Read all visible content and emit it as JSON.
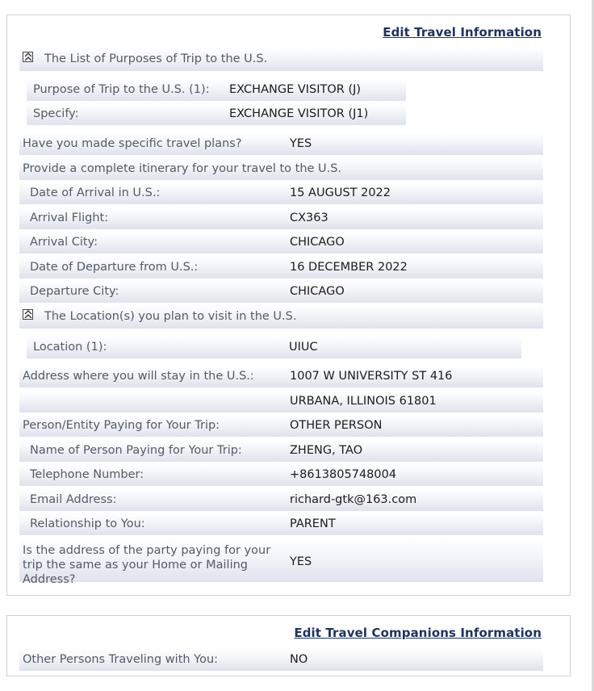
{
  "travel": {
    "edit_link": "Edit Travel Information",
    "purposes_section": {
      "title": "The List of Purposes of Trip to the U.S.",
      "purpose": {
        "label": "Purpose of Trip to the U.S. (1):",
        "value": "EXCHANGE VISITOR (J)"
      },
      "specify": {
        "label": "Specify:",
        "value": "EXCHANGE VISITOR (J1)"
      }
    },
    "travel_plans": {
      "label": "Have you made specific travel plans?",
      "value": "YES"
    },
    "itinerary_prompt": "Provide a complete itinerary for your travel to the U.S.",
    "arrival_date": {
      "label": "Date of Arrival in U.S.:",
      "value": "15 AUGUST 2022"
    },
    "arrival_flight": {
      "label": "Arrival Flight:",
      "value": "CX363"
    },
    "arrival_city": {
      "label": "Arrival City:",
      "value": "CHICAGO"
    },
    "departure_date": {
      "label": "Date of Departure from U.S.:",
      "value": "16 DECEMBER 2022"
    },
    "departure_city": {
      "label": "Departure City:",
      "value": "CHICAGO"
    },
    "locations_section": {
      "title": "The Location(s) you plan to visit in the U.S.",
      "location": {
        "label": "Location (1):",
        "value": "UIUC"
      }
    },
    "address": {
      "label": "Address where you will stay in the U.S.:",
      "line1": "1007 W UNIVERSITY ST 416",
      "line2": "URBANA, ILLINOIS 61801"
    },
    "payer": {
      "label": "Person/Entity Paying for Your Trip:",
      "value": "OTHER PERSON"
    },
    "payer_name": {
      "label": "Name of Person Paying for Your Trip:",
      "value": "ZHENG, TAO"
    },
    "phone": {
      "label": "Telephone Number:",
      "value": "+8613805748004"
    },
    "email": {
      "label": "Email Address:",
      "value": "richard-gtk@163.com"
    },
    "relationship": {
      "label": "Relationship to You:",
      "value": "PARENT"
    },
    "same_address": {
      "label": "Is the address of the party paying for your trip the same as your Home or Mailing Address?",
      "value": "YES"
    }
  },
  "companions": {
    "edit_link": "Edit Travel Companions Information",
    "others": {
      "label": "Other Persons Traveling with You:",
      "value": "NO"
    }
  },
  "icons": {
    "collapse": "collapse-up-icon"
  }
}
